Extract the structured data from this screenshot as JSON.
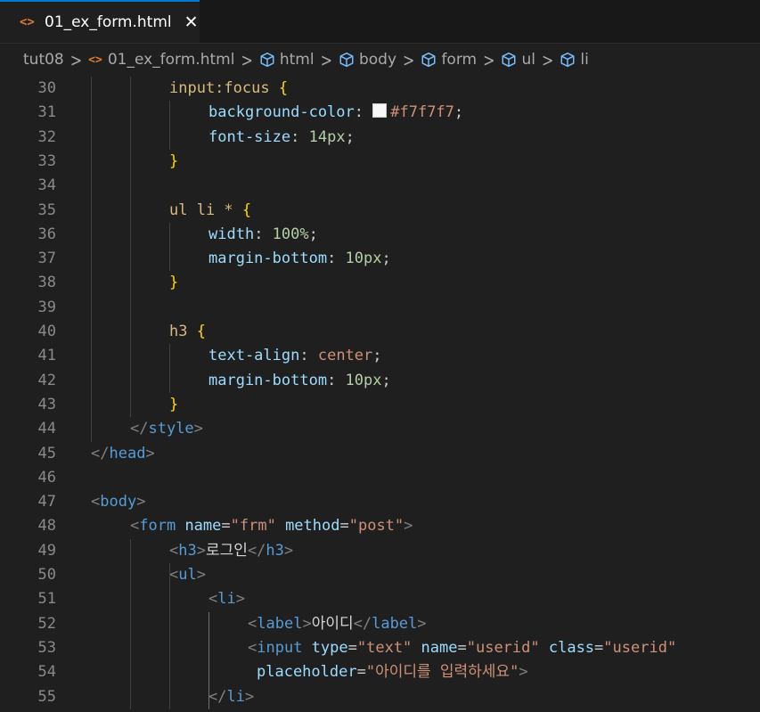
{
  "tab": {
    "icon": "html-file-icon",
    "label": "01_ex_form.html",
    "close_glyph": "✕"
  },
  "breadcrumb": {
    "items": [
      {
        "label": "tut08",
        "icon": ""
      },
      {
        "label": "01_ex_form.html",
        "icon": "html-file-icon"
      },
      {
        "label": "html",
        "icon": "symbol-element-icon"
      },
      {
        "label": "body",
        "icon": "symbol-element-icon"
      },
      {
        "label": "form",
        "icon": "symbol-element-icon"
      },
      {
        "label": "ul",
        "icon": "symbol-element-icon"
      },
      {
        "label": "li",
        "icon": "symbol-element-icon"
      }
    ]
  },
  "colors": {
    "selector": "#d7ba7d",
    "brace": "#ffd700",
    "property": "#9cdcfe",
    "number": "#b5cea8",
    "value": "#ce9178",
    "tag": "#569cd6",
    "tag_bracket": "#808080",
    "attribute": "#9cdcfe",
    "string": "#ce9178",
    "accent": "#0078d4",
    "html_icon": "#e37933"
  },
  "editor": {
    "lines": [
      {
        "n": "30",
        "tokens": [
          [
            "sel",
            "input:focus "
          ],
          [
            "brace",
            "{"
          ]
        ]
      },
      {
        "n": "31",
        "tokens": [
          [
            "prop",
            "background-color"
          ],
          [
            "punct",
            ": "
          ],
          [
            "swatch",
            ""
          ],
          [
            "val",
            "#f7f7f7"
          ],
          [
            "punct",
            ";"
          ]
        ]
      },
      {
        "n": "32",
        "tokens": [
          [
            "prop",
            "font-size"
          ],
          [
            "punct",
            ": "
          ],
          [
            "num",
            "14px"
          ],
          [
            "punct",
            ";"
          ]
        ]
      },
      {
        "n": "33",
        "tokens": [
          [
            "brace",
            "}"
          ]
        ]
      },
      {
        "n": "34",
        "tokens": []
      },
      {
        "n": "35",
        "tokens": [
          [
            "sel",
            "ul li * "
          ],
          [
            "brace",
            "{"
          ]
        ]
      },
      {
        "n": "36",
        "tokens": [
          [
            "prop",
            "width"
          ],
          [
            "punct",
            ": "
          ],
          [
            "num",
            "100%"
          ],
          [
            "punct",
            ";"
          ]
        ]
      },
      {
        "n": "37",
        "tokens": [
          [
            "prop",
            "margin-bottom"
          ],
          [
            "punct",
            ": "
          ],
          [
            "num",
            "10px"
          ],
          [
            "punct",
            ";"
          ]
        ]
      },
      {
        "n": "38",
        "tokens": [
          [
            "brace",
            "}"
          ]
        ]
      },
      {
        "n": "39",
        "tokens": []
      },
      {
        "n": "40",
        "tokens": [
          [
            "sel",
            "h3 "
          ],
          [
            "brace",
            "{"
          ]
        ]
      },
      {
        "n": "41",
        "tokens": [
          [
            "prop",
            "text-align"
          ],
          [
            "punct",
            ": "
          ],
          [
            "val",
            "center"
          ],
          [
            "punct",
            ";"
          ]
        ]
      },
      {
        "n": "42",
        "tokens": [
          [
            "prop",
            "margin-bottom"
          ],
          [
            "punct",
            ": "
          ],
          [
            "num",
            "10px"
          ],
          [
            "punct",
            ";"
          ]
        ]
      },
      {
        "n": "43",
        "tokens": [
          [
            "brace",
            "}"
          ]
        ]
      },
      {
        "n": "44",
        "tokens": [
          [
            "tagb",
            "</"
          ],
          [
            "tag",
            "style"
          ],
          [
            "tagb",
            ">"
          ]
        ]
      },
      {
        "n": "45",
        "tokens": [
          [
            "tagb",
            "</"
          ],
          [
            "tag",
            "head"
          ],
          [
            "tagb",
            ">"
          ]
        ]
      },
      {
        "n": "46",
        "tokens": []
      },
      {
        "n": "47",
        "tokens": [
          [
            "tagb",
            "<"
          ],
          [
            "tag",
            "body"
          ],
          [
            "tagb",
            ">"
          ]
        ]
      },
      {
        "n": "48",
        "tokens": [
          [
            "tagb",
            "<"
          ],
          [
            "tag",
            "form "
          ],
          [
            "attr",
            "name"
          ],
          [
            "punct",
            "="
          ],
          [
            "str",
            "\"frm\" "
          ],
          [
            "attr",
            "method"
          ],
          [
            "punct",
            "="
          ],
          [
            "str",
            "\"post\""
          ],
          [
            "tagb",
            ">"
          ]
        ]
      },
      {
        "n": "49",
        "tokens": [
          [
            "tagb",
            "<"
          ],
          [
            "tag",
            "h3"
          ],
          [
            "tagb",
            ">"
          ],
          [
            "txt",
            "로그인"
          ],
          [
            "tagb",
            "</"
          ],
          [
            "tag",
            "h3"
          ],
          [
            "tagb",
            ">"
          ]
        ]
      },
      {
        "n": "50",
        "tokens": [
          [
            "tagb",
            "<"
          ],
          [
            "tag",
            "ul"
          ],
          [
            "tagb",
            ">"
          ]
        ]
      },
      {
        "n": "51",
        "tokens": [
          [
            "tagb",
            "<"
          ],
          [
            "tag",
            "li"
          ],
          [
            "tagb",
            ">"
          ]
        ]
      },
      {
        "n": "52",
        "tokens": [
          [
            "tagb",
            "<"
          ],
          [
            "tag",
            "label"
          ],
          [
            "tagb",
            ">"
          ],
          [
            "txt",
            "아이디"
          ],
          [
            "tagb",
            "</"
          ],
          [
            "tag",
            "label"
          ],
          [
            "tagb",
            ">"
          ]
        ]
      },
      {
        "n": "53",
        "tokens": [
          [
            "tagb",
            "<"
          ],
          [
            "tag",
            "input "
          ],
          [
            "attr",
            "type"
          ],
          [
            "punct",
            "="
          ],
          [
            "str",
            "\"text\" "
          ],
          [
            "attr",
            "name"
          ],
          [
            "punct",
            "="
          ],
          [
            "str",
            "\"userid\" "
          ],
          [
            "attr",
            "class"
          ],
          [
            "punct",
            "="
          ],
          [
            "str",
            "\"userid\""
          ]
        ]
      },
      {
        "n": "54",
        "tokens": [
          [
            "attr",
            "placeholder"
          ],
          [
            "punct",
            "="
          ],
          [
            "str",
            "\"아이디를 입력하세요\""
          ],
          [
            "tagb",
            ">"
          ]
        ]
      },
      {
        "n": "55",
        "tokens": [
          [
            "tagb",
            "</"
          ],
          [
            "tag",
            "li"
          ],
          [
            "tagb",
            ">"
          ]
        ]
      }
    ]
  }
}
